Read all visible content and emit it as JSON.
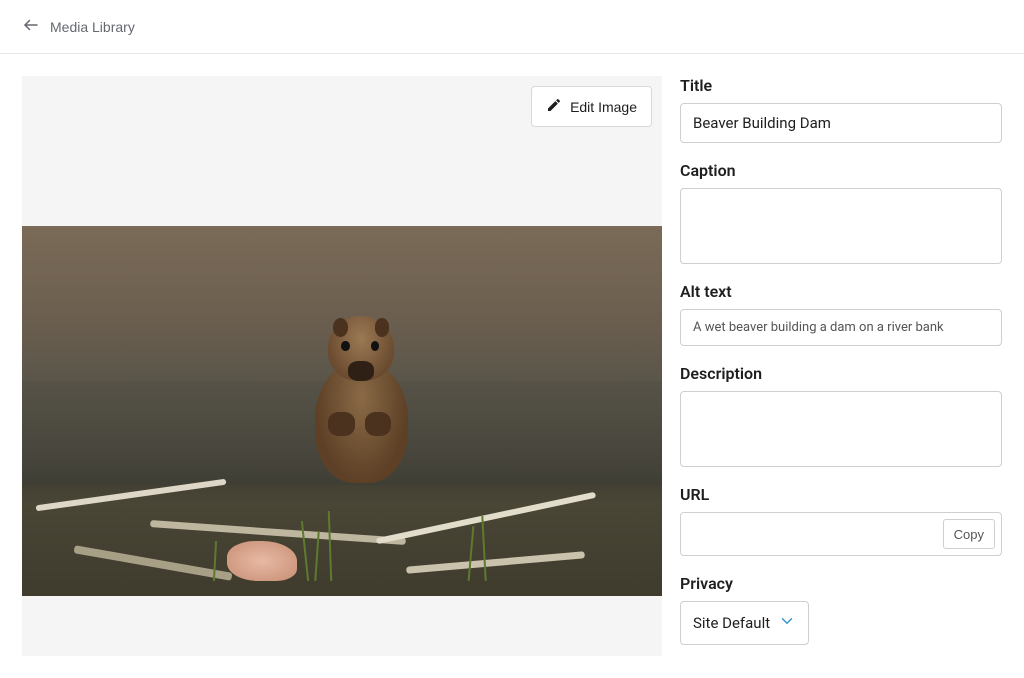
{
  "header": {
    "back_label": "Media Library"
  },
  "preview": {
    "edit_label": "Edit Image",
    "image_description": "Photograph of a wet beaver sitting upright among sticks, grass and debris on a riverbank with murky water behind it"
  },
  "form": {
    "title_label": "Title",
    "title_value": "Beaver Building Dam",
    "caption_label": "Caption",
    "caption_value": "",
    "alttext_label": "Alt text",
    "alttext_value": "A wet beaver building a dam on a river bank",
    "description_label": "Description",
    "description_value": "",
    "url_label": "URL",
    "url_value": "",
    "copy_label": "Copy",
    "privacy_label": "Privacy",
    "privacy_value": "Site Default"
  }
}
